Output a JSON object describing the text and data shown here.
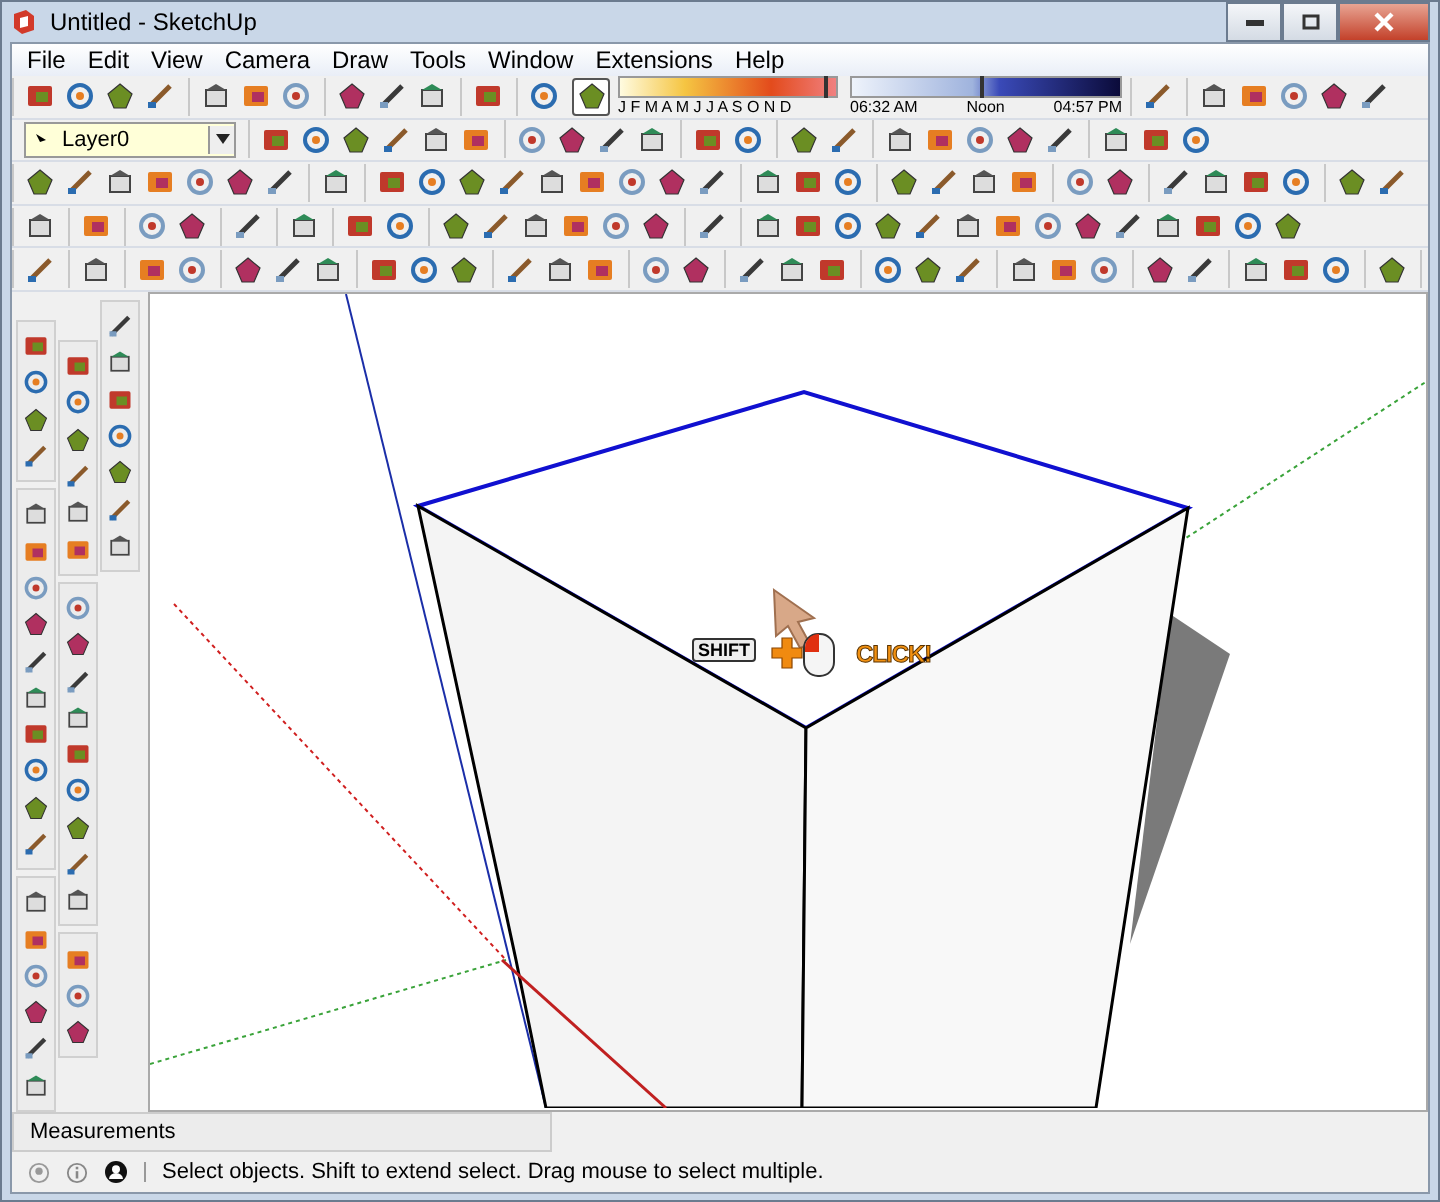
{
  "window": {
    "title": "Untitled - SketchUp"
  },
  "menu": [
    "File",
    "Edit",
    "View",
    "Camera",
    "Draw",
    "Tools",
    "Window",
    "Extensions",
    "Help"
  ],
  "layer": {
    "value": "Layer0"
  },
  "shadow_settings": {
    "month_slider": {
      "level": 0.94
    },
    "time_slider": {
      "level": 0.48
    },
    "months": "J F M A M J J A S O N D",
    "time_start": "06:32 AM",
    "time_mid": "Noon",
    "time_end": "04:57 PM"
  },
  "canvas_hint": {
    "key": "SHIFT",
    "action": "CLICK!"
  },
  "measurements": {
    "label": "Measurements"
  },
  "status_bar": {
    "text": "Select objects. Shift to extend select. Drag mouse to select multiple."
  }
}
